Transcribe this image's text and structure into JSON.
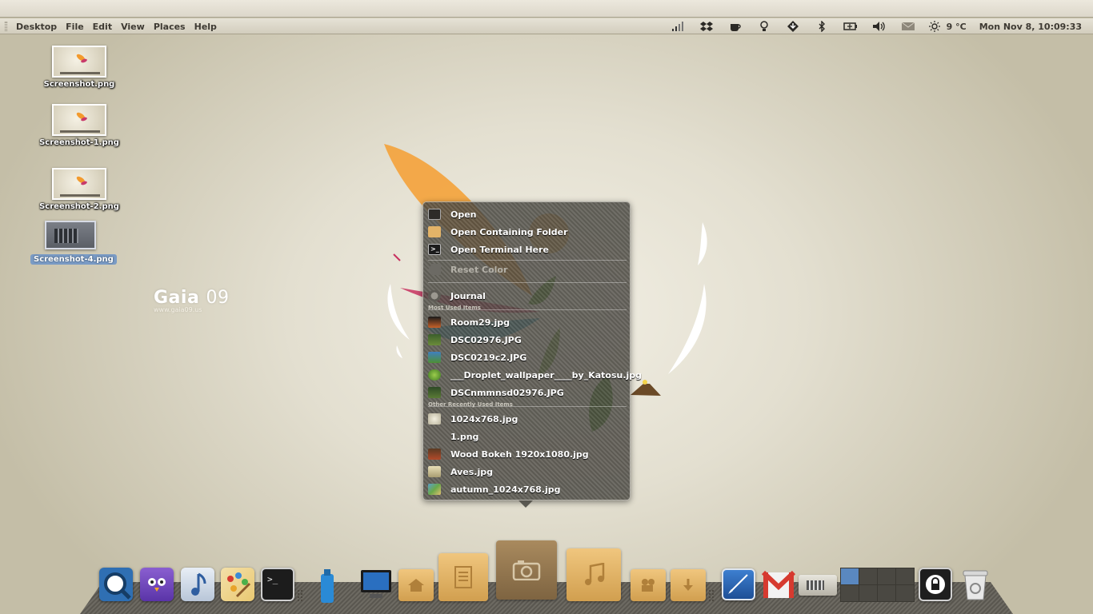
{
  "panel": {
    "menus": [
      "Desktop",
      "File",
      "Edit",
      "View",
      "Places",
      "Help"
    ],
    "weather": "9 °C",
    "clock": "Mon Nov  8, 10:09:33"
  },
  "desktop_icons": [
    {
      "label": "Screenshot.png"
    },
    {
      "label": "Screenshot-1.png"
    },
    {
      "label": "Screenshot-2.png"
    },
    {
      "label": "Screenshot-4.png",
      "selected": true
    }
  ],
  "wallpaper": {
    "brand": "Gaia",
    "brand_number": "09",
    "url": "www.gaia09.us"
  },
  "context_menu": {
    "open": "Open",
    "open_folder": "Open Containing Folder",
    "open_terminal": "Open Terminal Here",
    "reset_color": "Reset Color",
    "journal": "Journal",
    "most_used_header": "Most Used Items",
    "most_used": [
      "Room29.jpg",
      "DSC02976.JPG",
      "DSC0219c2.JPG",
      "___Droplet_wallpaper____by_Katosu.jpg",
      "DSCnmmnsd02976.JPG"
    ],
    "other_header": "Other Recently Used Items",
    "other": [
      "1024x768.jpg",
      "1.png",
      "Wood Bokeh 1920x1080.jpg",
      "Aves.jpg",
      "autumn_1024x768.jpg"
    ]
  },
  "colors": {
    "panel": "#dcd7ca",
    "menu_bg": "#5a5852",
    "folder": "#e3b368",
    "selection": "#7a9bc5"
  }
}
